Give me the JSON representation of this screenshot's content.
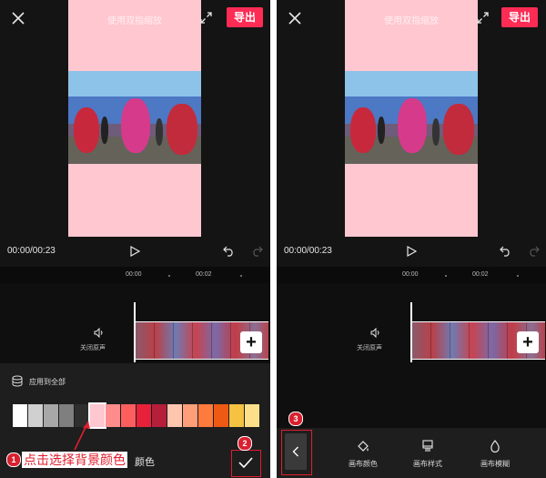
{
  "left_screen": {
    "watermark": "使用双指缩放",
    "export_label": "导出",
    "time": "00:00/00:23",
    "ruler": [
      "00:00",
      "00:02"
    ],
    "mute_label": "关闭原声",
    "apply_all_label": "应用到全部",
    "swatches": [
      "#ffffff",
      "#d0d0d0",
      "#a8a8a8",
      "#7f7f7f",
      "#2e2e2e",
      "#ffc7d0",
      "#ff8c8c",
      "#ff5e5e",
      "#e8213b",
      "#b51f3a",
      "#ffc6ae",
      "#ff9f7a",
      "#ff7a3d",
      "#ee5a14",
      "#f5c242",
      "#ffe08a"
    ],
    "selected_swatch": "#ffc7d0",
    "callout_number": "1",
    "callout_text": "点击选择背景颜色",
    "tab_label": "颜色",
    "confirm_number": "2"
  },
  "right_screen": {
    "watermark": "使用双指缩放",
    "export_label": "导出",
    "time": "00:00/00:23",
    "ruler": [
      "00:00",
      "00:02"
    ],
    "mute_label": "关闭原声",
    "back_number": "3",
    "tools": [
      {
        "label": "画布颜色",
        "icon": "paint-bucket-icon"
      },
      {
        "label": "画布样式",
        "icon": "brush-icon"
      },
      {
        "label": "画布模糊",
        "icon": "drop-icon"
      }
    ]
  },
  "colors": {
    "accent": "#fe2c55",
    "annotation": "#e01e2e",
    "canvas": "#ffc7d0"
  }
}
